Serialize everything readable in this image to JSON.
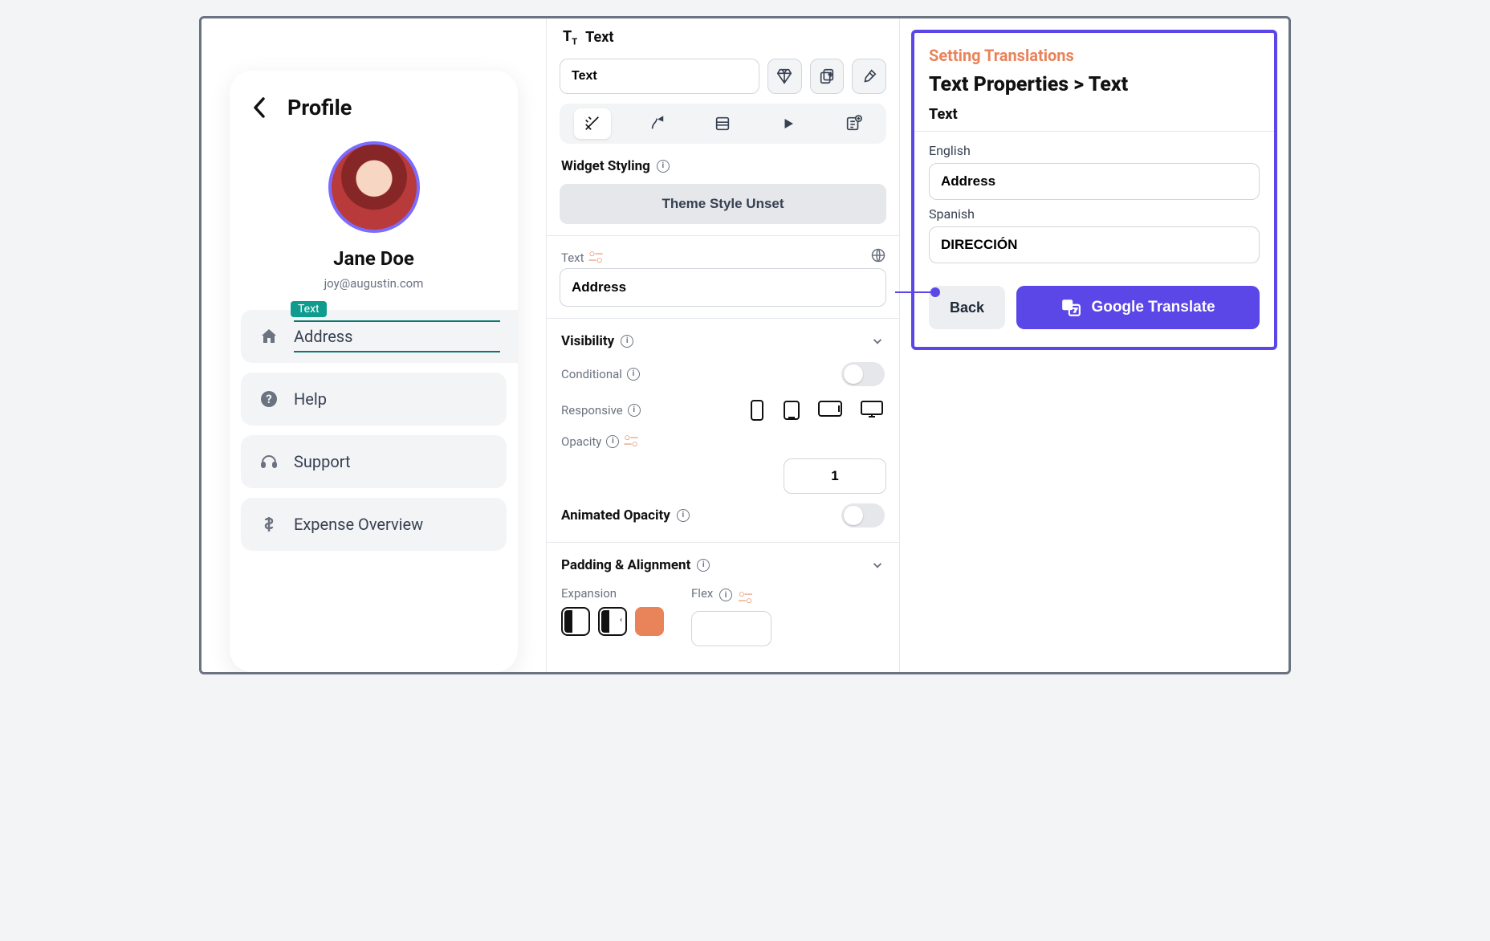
{
  "preview": {
    "header_title": "Profile",
    "user_name": "Jane Doe",
    "user_email": "joy@augustin.com",
    "selected_badge": "Text",
    "menu": {
      "address": "Address",
      "help": "Help",
      "support": "Support",
      "expense": "Expense Overview"
    }
  },
  "props": {
    "widget_type": "Text",
    "name_value": "Text",
    "section_styling": "Widget Styling",
    "theme_button": "Theme Style Unset",
    "text_label": "Text",
    "text_value": "Address",
    "visibility_label": "Visibility",
    "conditional_label": "Conditional",
    "responsive_label": "Responsive",
    "opacity_label": "Opacity",
    "opacity_value": "1",
    "anim_opacity_label": "Animated Opacity",
    "padding_label": "Padding & Alignment",
    "expansion_label": "Expansion",
    "flex_label": "Flex"
  },
  "trans": {
    "heading": "Setting Translations",
    "breadcrumb": "Text Properties > Text",
    "subheading": "Text",
    "english_label": "English",
    "english_value": "Address",
    "spanish_label": "Spanish",
    "spanish_value": "DIRECCIÓN",
    "back": "Back",
    "google_translate": "Google Translate"
  }
}
